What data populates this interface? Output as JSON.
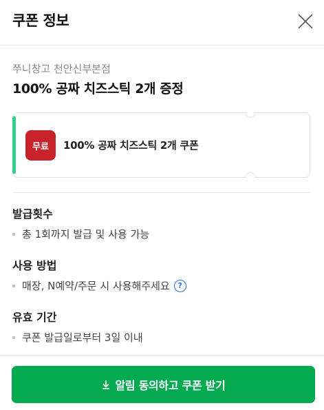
{
  "header": {
    "title": "쿠폰 정보",
    "close_icon": "close-x"
  },
  "coupon": {
    "store_name": "쭈니창고 천안신부본점",
    "headline": "100% 공짜 치즈스틱 2개 증정",
    "badge": "무료",
    "name": "100% 공짜 치즈스틱 2개 쿠폰",
    "accent_color": "#2fd08a",
    "badge_color": "#c8232c"
  },
  "sections": [
    {
      "title": "발급횟수",
      "item": "총 1회까지 발급 및 사용 가능"
    },
    {
      "title": "사용 방법",
      "item": "매장, N예약/주문 시 사용해주세요",
      "help_icon": "?"
    },
    {
      "title": "유효 기간",
      "item": "쿠폰 발급일로부터 3일 이내"
    }
  ],
  "cta": {
    "label": "알림 동의하고 쿠폰 받기",
    "icon": "download-arrow",
    "color": "#03aa4f"
  }
}
